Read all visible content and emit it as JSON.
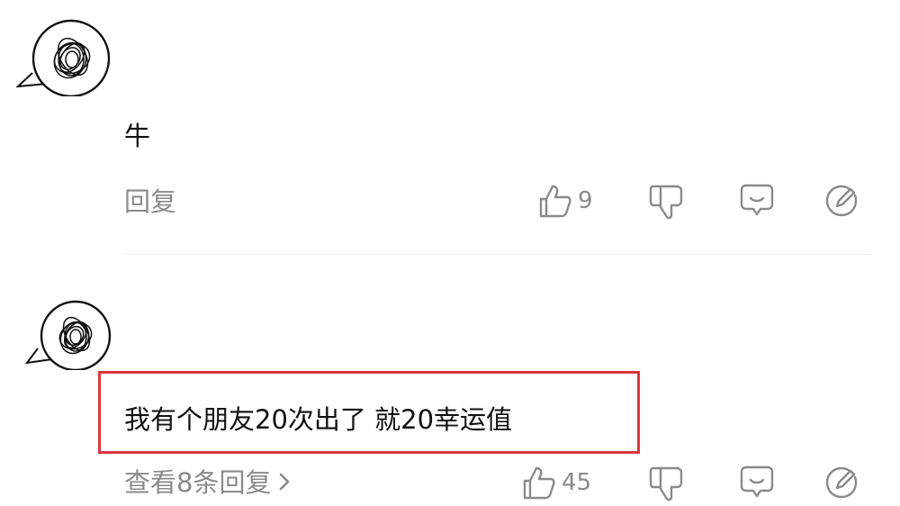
{
  "comments": [
    {
      "text": "牛",
      "reply_label": "回复",
      "like_count": "9"
    },
    {
      "text": "我有个朋友20次出了 就20幸运值",
      "view_replies_label": "查看8条回复",
      "like_count": "45"
    }
  ],
  "colors": {
    "meta_gray": "#8a8a8a",
    "highlight": "#d9363e"
  },
  "icons": [
    "avatar-scribble",
    "thumb-up-icon",
    "thumb-down-icon",
    "comment-icon",
    "edit-icon",
    "chevron-right-icon"
  ]
}
